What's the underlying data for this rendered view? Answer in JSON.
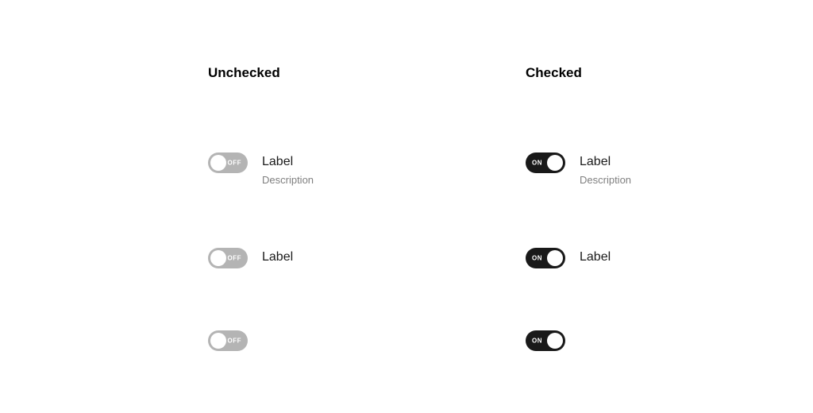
{
  "columns": {
    "unchecked": {
      "header": "Unchecked",
      "toggle_text": "OFF",
      "rows": [
        {
          "label": "Label",
          "description": "Description"
        },
        {
          "label": "Label"
        },
        {}
      ]
    },
    "checked": {
      "header": "Checked",
      "toggle_text": "ON",
      "rows": [
        {
          "label": "Label",
          "description": "Description"
        },
        {
          "label": "Label"
        },
        {}
      ]
    }
  }
}
